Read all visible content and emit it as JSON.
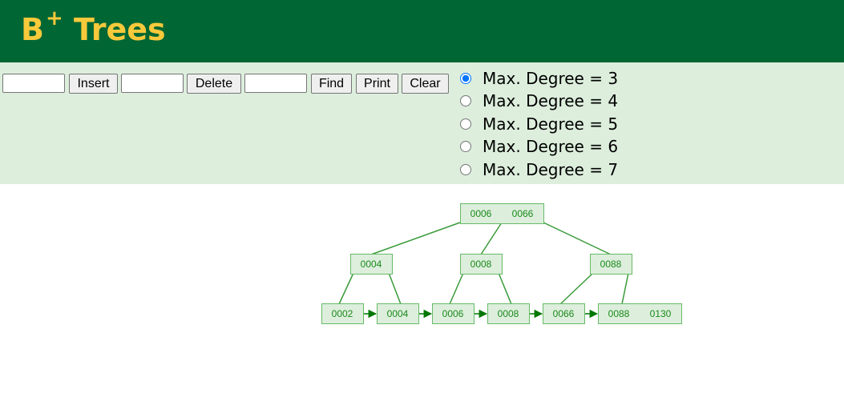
{
  "header": {
    "title": "B",
    "title_sup": "+",
    "title_rest": " Trees",
    "bg_color": "#006633",
    "title_color": "#f7c93b"
  },
  "toolbar": {
    "insert_value": "",
    "insert_label": "Insert",
    "delete_value": "",
    "delete_label": "Delete",
    "find_value": "",
    "find_label": "Find",
    "print_label": "Print",
    "clear_label": "Clear",
    "bg_color": "#ddeedd"
  },
  "degree_options": [
    {
      "label": "Max. Degree = 3",
      "checked": true
    },
    {
      "label": "Max. Degree = 4",
      "checked": false
    },
    {
      "label": "Max. Degree = 5",
      "checked": false
    },
    {
      "label": "Max. Degree = 6",
      "checked": false
    },
    {
      "label": "Max. Degree = 7",
      "checked": false
    }
  ],
  "tree": {
    "root": [
      "0006",
      "0066"
    ],
    "internal": [
      [
        "0004"
      ],
      [
        "0008"
      ],
      [
        "0088"
      ]
    ],
    "leaves": [
      [
        "0002"
      ],
      [
        "0004"
      ],
      [
        "0006"
      ],
      [
        "0008"
      ],
      [
        "0066"
      ],
      [
        "0088",
        "0130"
      ]
    ],
    "node_fill": "#ddeedd",
    "node_stroke": "#66bb66",
    "text_color": "#1a8a1a",
    "link_color": "#007700"
  }
}
